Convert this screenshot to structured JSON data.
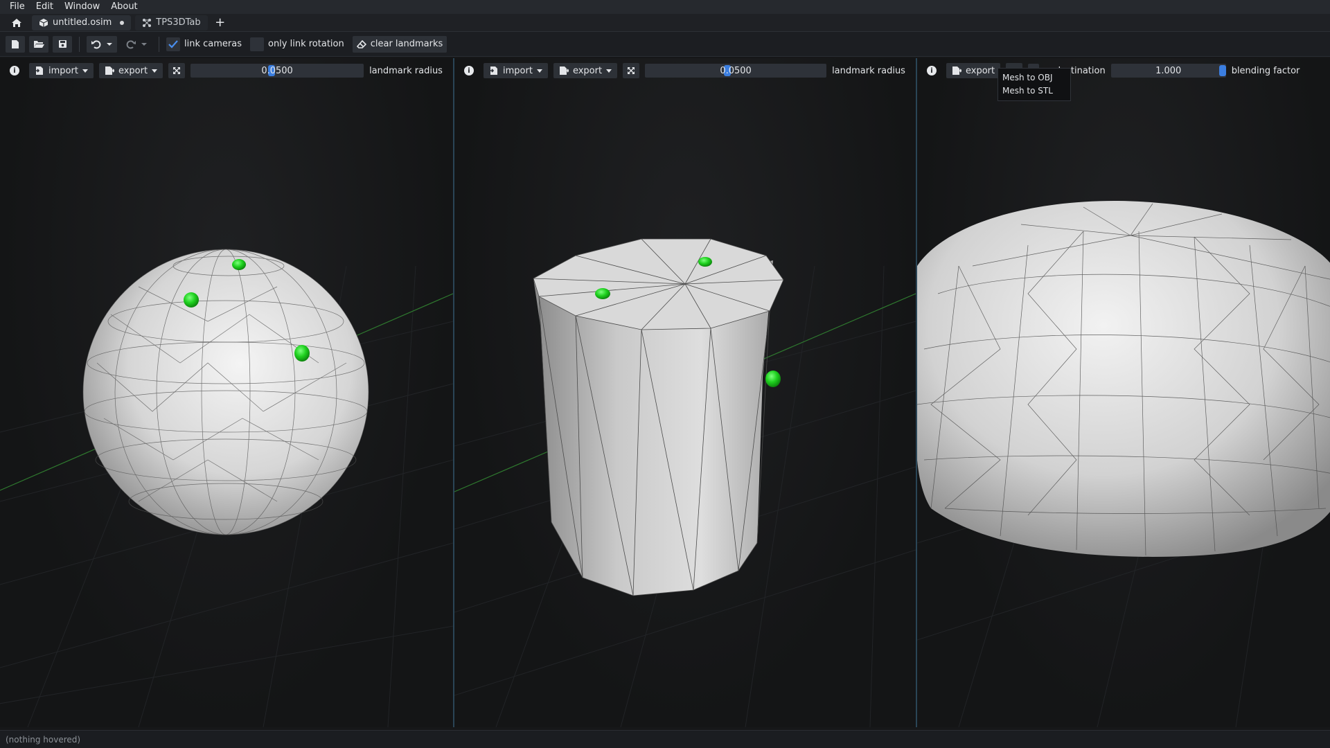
{
  "menubar": {
    "items": [
      "File",
      "Edit",
      "Window",
      "About"
    ]
  },
  "tabs": {
    "items": [
      {
        "label": "untitled.osim",
        "icon": "cube-icon",
        "modified": true
      },
      {
        "label": "TPS3DTab",
        "icon": "nodes-icon",
        "modified": false
      }
    ]
  },
  "toolbar": {
    "link_cameras_label": "link cameras",
    "link_cameras_checked": true,
    "only_link_rotation_label": "only link rotation",
    "only_link_rotation_checked": false,
    "clear_landmarks_label": "clear landmarks"
  },
  "panels": [
    {
      "import_label": "import",
      "export_label": "export",
      "slider_value": "0.0500",
      "slider_label": "landmark radius",
      "mesh": "sphere"
    },
    {
      "import_label": "import",
      "export_label": "export",
      "slider_value": "0.0500",
      "slider_label": "landmark radius",
      "mesh": "cylinder"
    },
    {
      "export_label": "export",
      "show_destination_label": "ow destination",
      "blending_value": "1.000",
      "blending_label": "blending factor",
      "mesh": "blended"
    }
  ],
  "export_popup": {
    "items": [
      "Mesh to OBJ",
      "Mesh to STL"
    ]
  },
  "status": {
    "text": "(nothing hovered)"
  },
  "colors": {
    "landmark": "#1fd11f",
    "accent": "#3b7ee0",
    "separator": "#2a4556"
  }
}
